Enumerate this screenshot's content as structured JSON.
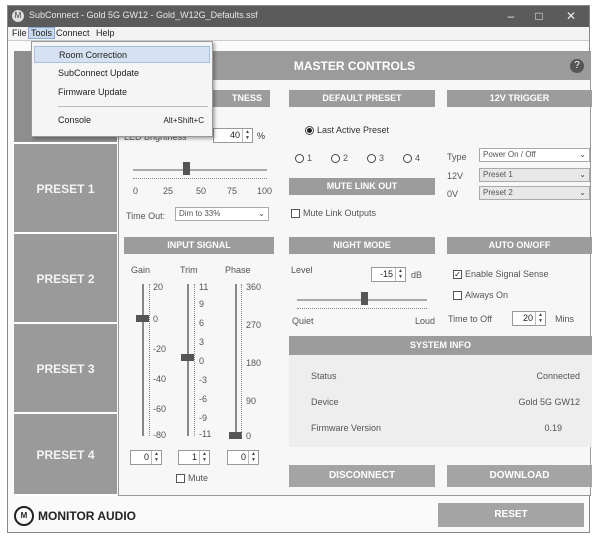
{
  "window": {
    "title": "SubConnect - Gold 5G GW12 - Gold_W12G_Defaults.ssf",
    "minimize": "–",
    "maximize": "□",
    "close": "✕",
    "app_icon": "M"
  },
  "menubar": {
    "items": [
      {
        "label": "File"
      },
      {
        "label": "Tools"
      },
      {
        "label": "Connect"
      },
      {
        "label": "Help"
      }
    ]
  },
  "tools_menu": {
    "items": [
      {
        "label": "Room Correction",
        "highlighted": true
      },
      {
        "label": "SubConnect Update"
      },
      {
        "label": "Firmware Update"
      },
      {
        "label": "Console",
        "shortcut": "Alt+Shift+C"
      }
    ]
  },
  "sidebar": {
    "presets": [
      {
        "label": ""
      },
      {
        "label": "PRESET 1"
      },
      {
        "label": "PRESET 2"
      },
      {
        "label": "PRESET 3"
      },
      {
        "label": "PRESET 4"
      }
    ]
  },
  "logo": {
    "badge": "M",
    "text": "MONITOR AUDIO"
  },
  "main": {
    "title": "MASTER CONTROLS",
    "help_icon": "?"
  },
  "led": {
    "header": "LED BRIGHTNESS",
    "header_visible": "TNESS",
    "label": "LED Brightness",
    "value": "40",
    "unit": "%",
    "slider_value_pct": 40,
    "scale": [
      "0",
      "25",
      "50",
      "75",
      "100"
    ],
    "timeout_label": "Time Out:",
    "timeout_value": "Dim to 33%"
  },
  "default_preset": {
    "header": "DEFAULT PRESET",
    "last_active_label": "Last Active Preset",
    "options": [
      "1",
      "2",
      "3",
      "4"
    ]
  },
  "mute_link": {
    "header": "MUTE LINK OUT",
    "checkbox_label": "Mute Link Outputs"
  },
  "trigger": {
    "header": "12V TRIGGER",
    "type_label": "Type",
    "type_value": "Power On / Off",
    "v12_label": "12V",
    "v12_value": "Preset 1",
    "v0_label": "0V",
    "v0_value": "Preset 2"
  },
  "input_signal": {
    "header": "INPUT SIGNAL",
    "gain_label": "Gain",
    "trim_label": "Trim",
    "phase_label": "Phase",
    "gain_scale": [
      "20",
      "0",
      "-20",
      "-40",
      "-60",
      "-80"
    ],
    "trim_scale": [
      "11",
      "9",
      "6",
      "3",
      "0",
      "-3",
      "-6",
      "-9",
      "-11"
    ],
    "phase_scale": [
      "360",
      "270",
      "180",
      "90",
      "0"
    ],
    "gain_value": "0",
    "trim_value": "1",
    "phase_value": "0",
    "mute_label": "Mute"
  },
  "night_mode": {
    "header": "NIGHT MODE",
    "level_label": "Level",
    "value": "-15",
    "unit": "dB",
    "quiet_label": "Quiet",
    "loud_label": "Loud"
  },
  "auto_onoff": {
    "header": "AUTO ON/OFF",
    "enable_label": "Enable Signal Sense",
    "always_on_label": "Always On",
    "time_label": "Time to Off",
    "time_value": "20",
    "time_unit": "Mins"
  },
  "system_info": {
    "header": "SYSTEM INFO",
    "rows": [
      {
        "label": "Status",
        "value": "Connected"
      },
      {
        "label": "Device",
        "value": "Gold 5G GW12"
      },
      {
        "label": "Firmware Version",
        "value": "0.19"
      }
    ]
  },
  "actions": {
    "disconnect": "DISCONNECT",
    "download": "DOWNLOAD",
    "reset": "RESET"
  }
}
